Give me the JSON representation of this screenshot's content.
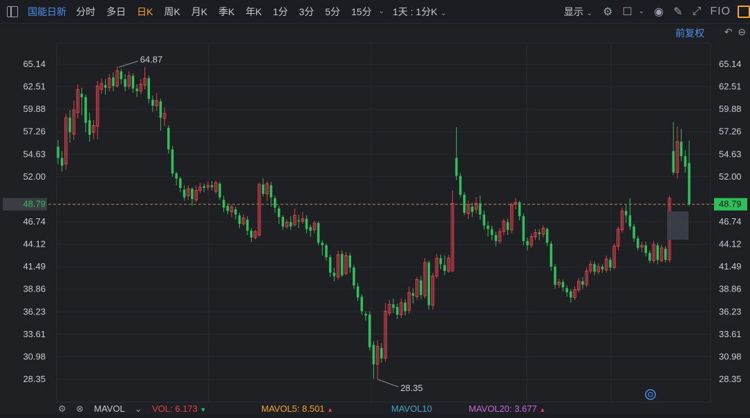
{
  "toolbar": {
    "title": "国能日新",
    "periods": [
      {
        "label": "分时",
        "active": false
      },
      {
        "label": "多日",
        "active": false
      },
      {
        "label": "日K",
        "active": true
      },
      {
        "label": "周K",
        "active": false
      },
      {
        "label": "月K",
        "active": false
      },
      {
        "label": "季K",
        "active": false
      },
      {
        "label": "年K",
        "active": false
      },
      {
        "label": "1分",
        "active": false
      },
      {
        "label": "3分",
        "active": false
      },
      {
        "label": "5分",
        "active": false
      },
      {
        "label": "15分",
        "active": false
      }
    ],
    "range_label": "1天 : 1分K",
    "display_label": "显示",
    "fio_label": "FIO"
  },
  "adjust_label": "前复权",
  "colors": {
    "up": "#e0434d",
    "down": "#2fbf5b",
    "accent": "#f5a623",
    "link": "#4c8fe8",
    "current_price_bg": "#2fbf5b"
  },
  "axis": {
    "ticks": [
      "65.14",
      "62.51",
      "59.88",
      "57.26",
      "54.63",
      "52.00",
      "48.79",
      "46.74",
      "44.12",
      "41.49",
      "38.86",
      "36.23",
      "33.61",
      "30.98",
      "28.35"
    ],
    "min": 28.35,
    "max": 65.14,
    "current_price": "48.79"
  },
  "annotations": {
    "high_label": "64.87",
    "low_label": "28.35"
  },
  "volume_bar": {
    "mavol_label": "MAVOL",
    "vol_label": "VOL: 6.173",
    "mavol5_label": "MAVOL5: 8.501",
    "mavol10_label": "MAVOL10",
    "mavol20_label": "MAVOL20: 3.677"
  },
  "chart_data": {
    "type": "candlestick",
    "ylim": [
      28.35,
      65.14
    ],
    "candles": [
      [
        55.5,
        54.2,
        56.3,
        53.5
      ],
      [
        54.2,
        53.3,
        55.0,
        52.6
      ],
      [
        53.5,
        58.9,
        59.4,
        52.8
      ],
      [
        58.9,
        57.2,
        59.8,
        56.0
      ],
      [
        57.0,
        59.8,
        60.9,
        56.3
      ],
      [
        59.5,
        62.2,
        62.8,
        58.8
      ],
      [
        61.7,
        61.3,
        62.4,
        59.2
      ],
      [
        61.3,
        58.3,
        61.6,
        57.2
      ],
      [
        58.6,
        56.9,
        59.5,
        56.1
      ],
      [
        57.2,
        58.0,
        58.6,
        56.4
      ],
      [
        57.9,
        62.6,
        63.2,
        56.4
      ],
      [
        62.2,
        62.9,
        63.5,
        61.7
      ],
      [
        62.7,
        62.4,
        63.4,
        61.6
      ],
      [
        62.4,
        63.5,
        64.0,
        62.0
      ],
      [
        63.6,
        62.6,
        64.2,
        62.0
      ],
      [
        62.6,
        64.4,
        64.87,
        62.4
      ],
      [
        64.3,
        63.4,
        64.6,
        62.8
      ],
      [
        63.4,
        62.5,
        64.0,
        62.0
      ],
      [
        62.6,
        63.8,
        64.3,
        62.2
      ],
      [
        63.8,
        62.3,
        64.1,
        61.8
      ],
      [
        62.3,
        62.0,
        62.8,
        61.3
      ],
      [
        62.0,
        62.8,
        63.4,
        61.6
      ],
      [
        62.7,
        63.5,
        64.8,
        62.2
      ],
      [
        63.5,
        61.1,
        63.8,
        60.6
      ],
      [
        61.0,
        60.3,
        61.5,
        59.6
      ],
      [
        60.3,
        60.9,
        61.8,
        59.7
      ],
      [
        60.8,
        58.9,
        61.1,
        57.4
      ],
      [
        58.8,
        59.4,
        60.1,
        57.9
      ],
      [
        57.7,
        55.2,
        58.0,
        54.7
      ],
      [
        55.2,
        52.4,
        55.6,
        52.0
      ],
      [
        52.4,
        51.8,
        52.6,
        51.0
      ],
      [
        51.8,
        50.7,
        52.0,
        50.2
      ],
      [
        50.5,
        49.6,
        51.0,
        49.2
      ],
      [
        49.8,
        50.6,
        51.0,
        49.3
      ],
      [
        50.6,
        49.4,
        50.8,
        48.6
      ],
      [
        49.3,
        50.4,
        51.0,
        49.0
      ],
      [
        50.4,
        50.8,
        51.3,
        50.1
      ],
      [
        50.9,
        50.7,
        51.2,
        50.2
      ],
      [
        50.8,
        51.0,
        51.4,
        50.4
      ],
      [
        51.0,
        50.8,
        51.5,
        50.4
      ],
      [
        50.3,
        51.3,
        51.6,
        50.0
      ],
      [
        51.2,
        49.6,
        51.4,
        49.3
      ],
      [
        49.3,
        48.4,
        49.8,
        47.9
      ],
      [
        48.6,
        48.0,
        48.9,
        47.6
      ],
      [
        47.9,
        48.5,
        48.8,
        47.3
      ],
      [
        48.2,
        47.6,
        48.5,
        47.0
      ],
      [
        47.5,
        46.5,
        47.8,
        46.0
      ],
      [
        46.5,
        47.2,
        47.6,
        46.3
      ],
      [
        47.0,
        45.7,
        47.4,
        45.2
      ],
      [
        45.7,
        44.9,
        46.0,
        44.4
      ],
      [
        44.9,
        45.6,
        45.8,
        44.7
      ],
      [
        45.2,
        51.1,
        51.3,
        45.0
      ],
      [
        51.1,
        50.0,
        51.8,
        49.7
      ],
      [
        50.0,
        51.2,
        51.5,
        49.2
      ],
      [
        51.0,
        49.6,
        51.4,
        48.5
      ],
      [
        49.5,
        48.4,
        49.8,
        47.8
      ],
      [
        48.3,
        47.3,
        48.6,
        46.5
      ],
      [
        47.3,
        46.2,
        47.5,
        45.8
      ],
      [
        46.2,
        46.7,
        47.0,
        45.9
      ],
      [
        46.7,
        46.2,
        47.4,
        45.8
      ],
      [
        46.4,
        47.5,
        48.3,
        46.2
      ],
      [
        46.9,
        46.8,
        47.6,
        46.0
      ],
      [
        46.8,
        47.1,
        47.9,
        46.5
      ],
      [
        47.1,
        45.9,
        47.5,
        45.4
      ],
      [
        46.1,
        45.7,
        46.4,
        45.0
      ],
      [
        45.8,
        46.6,
        46.9,
        45.4
      ],
      [
        46.6,
        44.3,
        46.8,
        44.0
      ],
      [
        44.3,
        44.0,
        44.6,
        42.8
      ],
      [
        44.0,
        42.6,
        44.2,
        42.2
      ],
      [
        42.6,
        40.8,
        42.9,
        40.3
      ],
      [
        40.8,
        40.4,
        41.4,
        39.8
      ],
      [
        40.3,
        42.9,
        43.4,
        40.0
      ],
      [
        43.0,
        40.5,
        43.4,
        40.3
      ],
      [
        40.7,
        42.8,
        43.2,
        40.5
      ],
      [
        42.8,
        41.4,
        43.1,
        40.8
      ],
      [
        41.4,
        39.3,
        41.7,
        38.9
      ],
      [
        39.2,
        37.9,
        39.6,
        37.5
      ],
      [
        38.0,
        36.3,
        38.3,
        35.9
      ],
      [
        36.0,
        35.8,
        36.3,
        35.2
      ],
      [
        35.9,
        32.1,
        36.3,
        31.7
      ],
      [
        32.4,
        30.1,
        32.8,
        28.4
      ],
      [
        30.1,
        32.2,
        32.9,
        28.35
      ],
      [
        32.0,
        30.8,
        32.6,
        30.3
      ],
      [
        30.8,
        36.3,
        37.3,
        30.4
      ],
      [
        36.1,
        37.1,
        37.6,
        35.8
      ],
      [
        37.1,
        36.7,
        37.8,
        36.1
      ],
      [
        36.8,
        35.9,
        37.2,
        35.4
      ],
      [
        35.9,
        37.3,
        37.8,
        35.5
      ],
      [
        37.3,
        36.3,
        37.7,
        35.8
      ],
      [
        36.4,
        38.5,
        39.2,
        36.0
      ],
      [
        38.4,
        38.1,
        39.0,
        37.2
      ],
      [
        38.0,
        40.0,
        40.3,
        37.6
      ],
      [
        39.9,
        38.2,
        40.4,
        37.7
      ],
      [
        38.1,
        42.0,
        42.5,
        37.8
      ],
      [
        42.0,
        37.0,
        42.2,
        36.5
      ],
      [
        37.0,
        40.4,
        40.8,
        36.5
      ],
      [
        40.4,
        42.5,
        43.0,
        40.1
      ],
      [
        42.5,
        41.8,
        42.9,
        41.2
      ],
      [
        41.7,
        41.0,
        42.8,
        40.5
      ],
      [
        41.0,
        42.5,
        42.9,
        40.8
      ],
      [
        41.0,
        48.9,
        50.4,
        40.9
      ],
      [
        54.2,
        52.1,
        57.8,
        51.6
      ],
      [
        52.1,
        49.9,
        52.5,
        49.6
      ],
      [
        49.9,
        47.8,
        50.2,
        47.5
      ],
      [
        47.7,
        48.7,
        49.2,
        47.1
      ],
      [
        48.5,
        47.9,
        49.0,
        47.3
      ],
      [
        48.2,
        48.9,
        49.6,
        47.7
      ],
      [
        48.9,
        47.6,
        49.8,
        47.0
      ],
      [
        47.6,
        46.3,
        48.1,
        45.8
      ],
      [
        46.3,
        45.9,
        46.8,
        45.0
      ],
      [
        45.9,
        45.2,
        46.3,
        44.6
      ],
      [
        45.2,
        44.5,
        45.6,
        43.9
      ],
      [
        44.5,
        45.6,
        46.0,
        44.2
      ],
      [
        45.6,
        46.8,
        47.1,
        45.2
      ],
      [
        46.7,
        45.8,
        47.1,
        45.2
      ],
      [
        45.8,
        48.7,
        49.0,
        45.4
      ],
      [
        48.8,
        49.0,
        49.5,
        48.2
      ],
      [
        49.0,
        47.4,
        49.2,
        46.9
      ],
      [
        47.4,
        44.5,
        47.7,
        44.0
      ],
      [
        44.5,
        44.0,
        44.9,
        43.4
      ],
      [
        44.0,
        45.0,
        45.4,
        43.7
      ],
      [
        45.0,
        45.5,
        45.9,
        44.6
      ],
      [
        45.5,
        45.3,
        45.9,
        44.6
      ],
      [
        45.3,
        46.0,
        46.3,
        44.9
      ],
      [
        45.9,
        44.3,
        46.1,
        43.9
      ],
      [
        44.2,
        41.5,
        44.5,
        41.0
      ],
      [
        41.5,
        39.4,
        41.8,
        38.9
      ],
      [
        39.4,
        39.7,
        40.1,
        39.0
      ],
      [
        39.7,
        39.1,
        40.0,
        38.6
      ],
      [
        39.0,
        38.5,
        39.3,
        38.0
      ],
      [
        38.6,
        37.9,
        38.9,
        37.3
      ],
      [
        37.9,
        38.8,
        39.2,
        37.6
      ],
      [
        38.8,
        39.8,
        40.2,
        38.5
      ],
      [
        39.8,
        39.4,
        40.3,
        38.9
      ],
      [
        39.4,
        41.0,
        41.4,
        39.1
      ],
      [
        41.0,
        41.8,
        42.2,
        40.7
      ],
      [
        41.8,
        40.9,
        42.1,
        40.5
      ],
      [
        40.9,
        41.5,
        41.9,
        40.6
      ],
      [
        41.5,
        41.2,
        41.8,
        40.8
      ],
      [
        41.1,
        42.4,
        42.8,
        40.8
      ],
      [
        42.3,
        41.4,
        42.6,
        41.0
      ],
      [
        41.4,
        43.9,
        44.2,
        41.2
      ],
      [
        43.9,
        45.9,
        46.2,
        43.4
      ],
      [
        45.8,
        48.0,
        48.4,
        45.5
      ],
      [
        48.0,
        47.5,
        48.7,
        46.6
      ],
      [
        47.5,
        46.2,
        49.5,
        45.8
      ],
      [
        46.2,
        44.8,
        46.5,
        44.4
      ],
      [
        44.8,
        43.7,
        45.1,
        43.4
      ],
      [
        43.8,
        44.0,
        44.4,
        43.2
      ],
      [
        44.0,
        43.1,
        44.4,
        42.7
      ],
      [
        43.1,
        42.2,
        43.4,
        41.9
      ],
      [
        42.2,
        44.1,
        44.5,
        41.9
      ],
      [
        44.0,
        42.3,
        44.3,
        41.8
      ],
      [
        42.2,
        43.7,
        44.1,
        42.0
      ],
      [
        43.6,
        42.3,
        43.9,
        42.0
      ],
      [
        42.3,
        49.5,
        49.8,
        42.0
      ],
      [
        55.0,
        52.5,
        58.4,
        52.2
      ],
      [
        52.5,
        56.1,
        57.9,
        51.8
      ],
      [
        56.1,
        54.4,
        57.6,
        53.8
      ],
      [
        54.4,
        53.2,
        55.1,
        52.5
      ],
      [
        53.6,
        48.79,
        56.2,
        48.6
      ]
    ]
  }
}
